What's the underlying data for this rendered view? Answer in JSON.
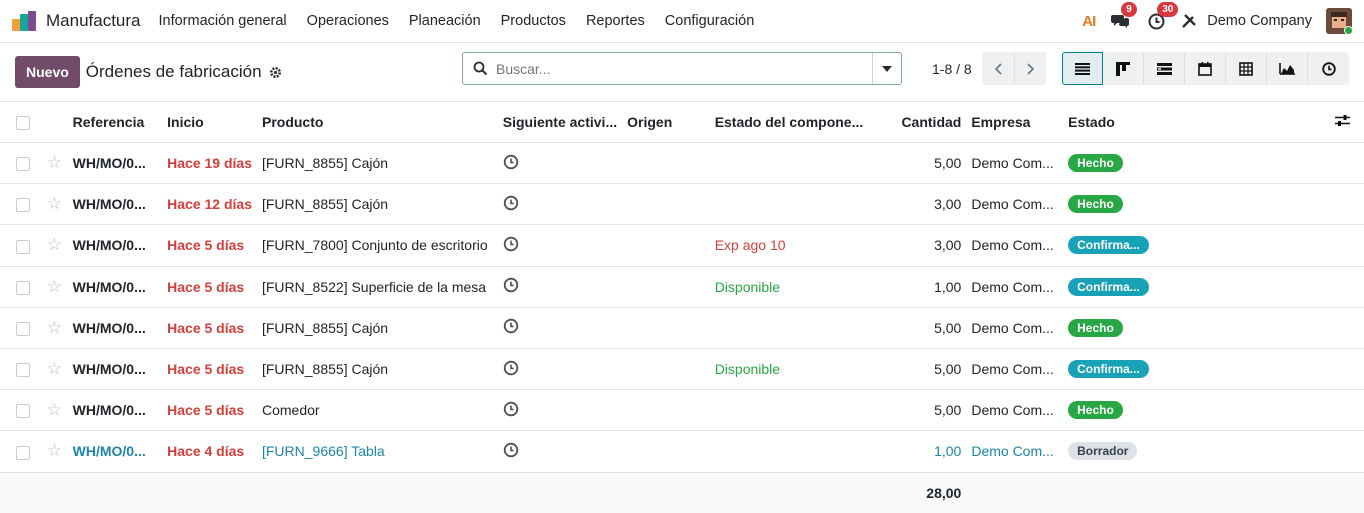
{
  "app": {
    "name": "Manufactura"
  },
  "menu": [
    "Información general",
    "Operaciones",
    "Planeación",
    "Productos",
    "Reportes",
    "Configuración"
  ],
  "navbar": {
    "messages_count": "9",
    "activities_count": "30",
    "company": "Demo Company",
    "ai_label": "AI"
  },
  "control": {
    "new_label": "Nuevo",
    "title": "Órdenes de fabricación",
    "search_placeholder": "Buscar...",
    "pager": "1-8 / 8"
  },
  "table": {
    "columns": [
      "Referencia",
      "Inicio",
      "Producto",
      "Siguiente activi...",
      "Origen",
      "Estado del compone...",
      "Cantidad",
      "Empresa",
      "Estado"
    ],
    "rows": [
      {
        "ref": "WH/MO/0...",
        "start": "Hace 19 días",
        "product": "[FURN_8855] Cajón",
        "origin": "",
        "component": "",
        "component_state": "",
        "qty": "5,00",
        "company": "Demo Com...",
        "state": "Hecho",
        "state_kind": "done"
      },
      {
        "ref": "WH/MO/0...",
        "start": "Hace 12 días",
        "product": "[FURN_8855] Cajón",
        "origin": "",
        "component": "",
        "component_state": "",
        "qty": "3,00",
        "company": "Demo Com...",
        "state": "Hecho",
        "state_kind": "done"
      },
      {
        "ref": "WH/MO/0...",
        "start": "Hace 5 días",
        "product": "[FURN_7800] Conjunto de escritorio",
        "origin": "",
        "component": "Exp ago 10",
        "component_state": "late",
        "qty": "3,00",
        "company": "Demo Com...",
        "state": "Confirma...",
        "state_kind": "confirmed"
      },
      {
        "ref": "WH/MO/0...",
        "start": "Hace 5 días",
        "product": "[FURN_8522] Superficie de la mesa",
        "origin": "",
        "component": "Disponible",
        "component_state": "ok",
        "qty": "1,00",
        "company": "Demo Com...",
        "state": "Confirma...",
        "state_kind": "confirmed"
      },
      {
        "ref": "WH/MO/0...",
        "start": "Hace 5 días",
        "product": "[FURN_8855] Cajón",
        "origin": "",
        "component": "",
        "component_state": "",
        "qty": "5,00",
        "company": "Demo Com...",
        "state": "Hecho",
        "state_kind": "done"
      },
      {
        "ref": "WH/MO/0...",
        "start": "Hace 5 días",
        "product": "[FURN_8855] Cajón",
        "origin": "",
        "component": "Disponible",
        "component_state": "ok",
        "qty": "5,00",
        "company": "Demo Com...",
        "state": "Confirma...",
        "state_kind": "confirmed"
      },
      {
        "ref": "WH/MO/0...",
        "start": "Hace 5 días",
        "product": "Comedor",
        "origin": "",
        "component": "",
        "component_state": "",
        "qty": "5,00",
        "company": "Demo Com...",
        "state": "Hecho",
        "state_kind": "done"
      },
      {
        "ref": "WH/MO/0...",
        "start": "Hace 4 días",
        "product": "[FURN_9666] Tabla",
        "origin": "",
        "component": "",
        "component_state": "",
        "qty": "1,00",
        "company": "Demo Com...",
        "state": "Borrador",
        "state_kind": "draft"
      }
    ],
    "total_qty": "28,00"
  },
  "colors": {
    "brand": "#714b67",
    "done": "#28a745",
    "confirmed": "#17a2b8",
    "late": "#d23f3a",
    "link": "#1f84a8"
  }
}
